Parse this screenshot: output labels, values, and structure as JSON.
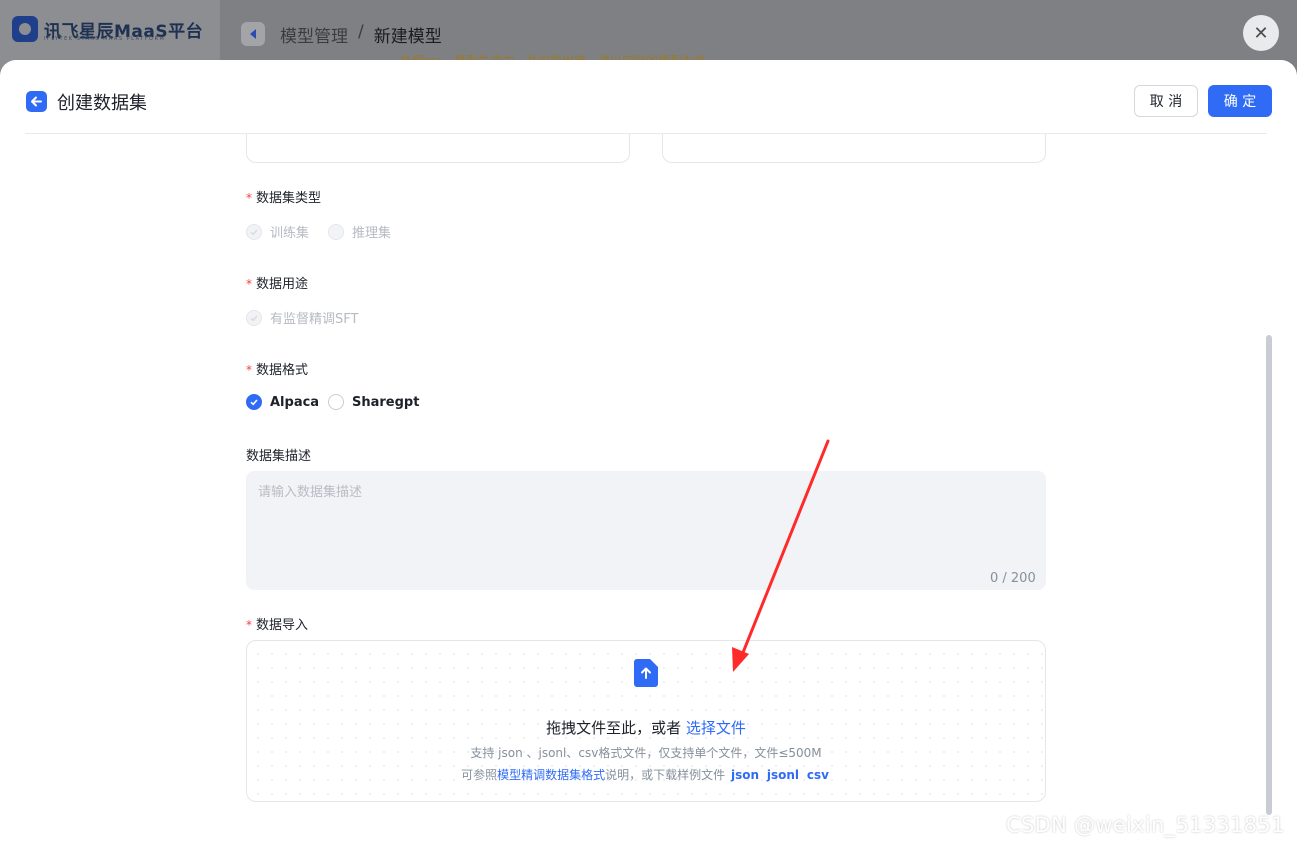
{
  "app": {
    "logo_text": "讯飞星辰MaaS平台",
    "logo_subtext": "IFLYTEK STARS MAAS PLATFORM",
    "breadcrumb": [
      "模型管理",
      "/",
      "新建模型"
    ],
    "warning_text": "处理ms，模型生成中，并可能出错，请以实际的模型为准"
  },
  "drawer": {
    "title": "创建数据集",
    "cancel_label": "取 消",
    "ok_label": "确 定"
  },
  "form": {
    "dataset_type": {
      "label": "数据集类型",
      "options": [
        "训练集",
        "推理集"
      ]
    },
    "purpose": {
      "label": "数据用途",
      "options": [
        "有监督精调SFT"
      ]
    },
    "format": {
      "label": "数据格式",
      "options": [
        "Alpaca",
        "Sharegpt"
      ],
      "selected": "Alpaca"
    },
    "description": {
      "label": "数据集描述",
      "placeholder": "请输入数据集描述",
      "value": "",
      "count": "0 / 200"
    },
    "import": {
      "label": "数据导入",
      "drop_text": "拖拽文件至此，或者",
      "select_link": "选择文件",
      "support_text": "支持 json 、jsonl、csv格式文件，仅支持单个文件，文件≤500M",
      "ref_prefix": "可参照",
      "ref_link": "模型精调数据集格式",
      "ref_suffix": "说明，或下载样例文件",
      "sample_links": [
        "json",
        "jsonl",
        "csv"
      ]
    }
  },
  "watermark": "CSDN @weixin_51331851",
  "colors": {
    "primary": "#2f6bf5",
    "required": "#f53f3f",
    "annotation_arrow": "#ff2a2a"
  }
}
